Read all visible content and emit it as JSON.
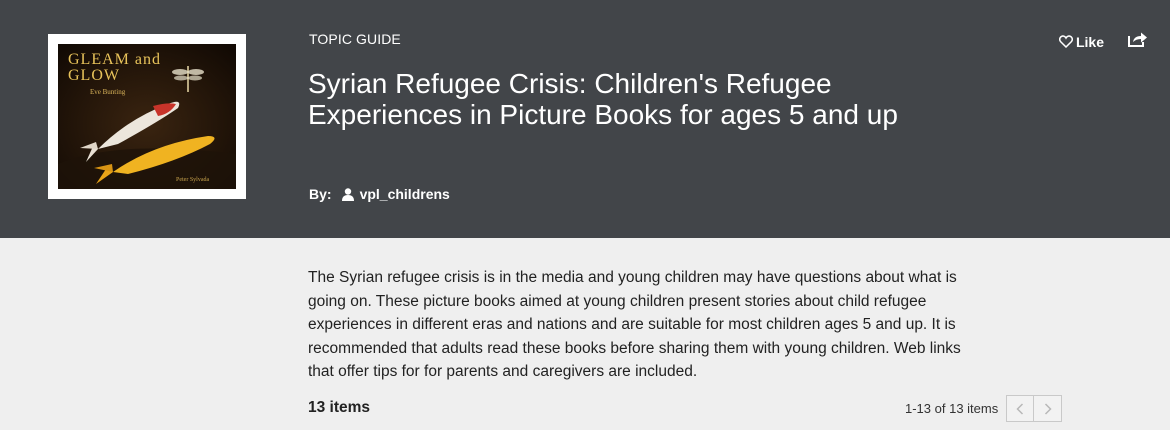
{
  "header": {
    "kicker": "TOPIC GUIDE",
    "title": "Syrian Refugee Crisis: Children's Refugee Experiences in Picture Books for ages 5 and up",
    "by_label": "By:",
    "username": "vpl_childrens",
    "like_label": "Like",
    "background": "#424549"
  },
  "cover": {
    "title_line1": "GLEAM and",
    "title_line2": "GLOW",
    "author": "Eve Bunting",
    "illustrator": "Peter Sylvada"
  },
  "description": "The Syrian refugee crisis is in the media and young children may have questions about what is going on. These picture books aimed at young children present stories about child refugee experiences in different eras and nations and are suitable for most children ages 5 and up. It is recommended that adults read these books before sharing them with young children. Web links that offer tips for for parents and caregivers are included.",
  "list": {
    "count_label": "13 items",
    "range_label": "1-13 of 13 items"
  },
  "icons": [
    "heart-icon",
    "share-icon",
    "user-icon",
    "chevron-left-icon",
    "chevron-right-icon"
  ]
}
